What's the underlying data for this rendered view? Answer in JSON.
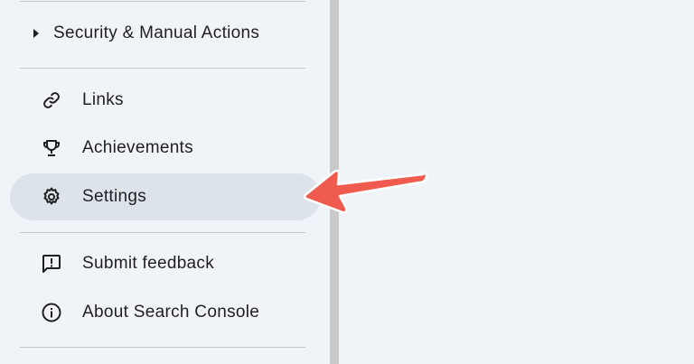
{
  "sidebar": {
    "expander": {
      "label": "Security & Manual Actions",
      "icon": "caret-right-icon"
    },
    "items": [
      {
        "label": "Links",
        "icon": "link-icon"
      },
      {
        "label": "Achievements",
        "icon": "trophy-icon"
      },
      {
        "label": "Settings",
        "icon": "gear-icon",
        "active": true
      },
      {
        "label": "Submit feedback",
        "icon": "feedback-icon"
      },
      {
        "label": "About Search Console",
        "icon": "info-icon"
      }
    ]
  },
  "annotation": {
    "arrow_color": "#ef5b4f",
    "arrow_icon": "arrow-left-icon"
  },
  "colors": {
    "background": "#f0f4f9",
    "active_item": "#dde3ea",
    "divider": "#c4c7c5",
    "panel_border": "#c9c9c9",
    "text": "#1f1f1f"
  }
}
